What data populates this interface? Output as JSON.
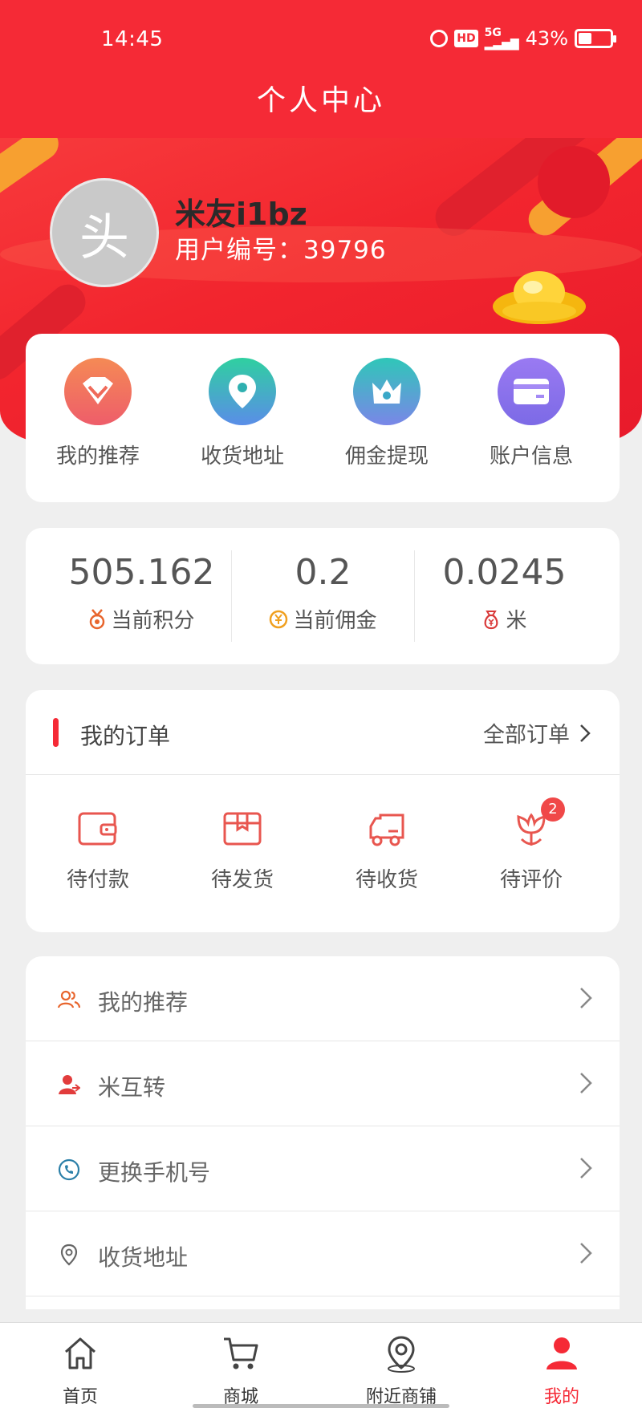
{
  "status_bar": {
    "time": "14:45",
    "network": "5G",
    "battery_text": "43%",
    "battery_level": 0.43,
    "hd_label": "HD"
  },
  "header": {
    "title": "个人中心"
  },
  "profile": {
    "avatar_text": "头",
    "name": "米友i1bz",
    "user_id_label": "用户编号：39796"
  },
  "quick_actions": [
    {
      "label": "我的推荐",
      "icon": "diamond-icon",
      "color": "#f0744c"
    },
    {
      "label": "收货地址",
      "icon": "location-pin-icon",
      "color": "#2ec7a2"
    },
    {
      "label": "佣金提现",
      "icon": "crown-icon",
      "color": "#36b7c7"
    },
    {
      "label": "账户信息",
      "icon": "card-icon",
      "color": "#8a6ff0"
    }
  ],
  "stats": [
    {
      "value": "505.162",
      "label": "当前积分",
      "icon": "medal-icon",
      "color": "#e8652d"
    },
    {
      "value": "0.2",
      "label": "当前佣金",
      "icon": "yen-coin-icon",
      "color": "#f0a020"
    },
    {
      "value": "0.0245",
      "label": "米",
      "icon": "money-bag-icon",
      "color": "#d93a3a"
    }
  ],
  "orders": {
    "title": "我的订单",
    "view_all": "全部订单",
    "items": [
      {
        "label": "待付款",
        "icon": "wallet-icon",
        "badge": null
      },
      {
        "label": "待发货",
        "icon": "package-icon",
        "badge": null
      },
      {
        "label": "待收货",
        "icon": "truck-icon",
        "badge": null
      },
      {
        "label": "待评价",
        "icon": "flower-icon",
        "badge": "2"
      }
    ]
  },
  "menu": [
    {
      "label": "我的推荐",
      "icon": "users-icon",
      "color": "#e8652d"
    },
    {
      "label": "米互转",
      "icon": "user-transfer-icon",
      "color": "#e23c3c"
    },
    {
      "label": "更换手机号",
      "icon": "phone-icon",
      "color": "#2b7fa8"
    },
    {
      "label": "收货地址",
      "icon": "map-pin-icon",
      "color": "#666666"
    }
  ],
  "tabbar": {
    "items": [
      {
        "label": "首页",
        "icon": "home-icon",
        "active": false
      },
      {
        "label": "商城",
        "icon": "cart-icon",
        "active": false
      },
      {
        "label": "附近商铺",
        "icon": "nearby-pin-icon",
        "active": false
      },
      {
        "label": "我的",
        "icon": "profile-icon",
        "active": true
      }
    ]
  },
  "colors": {
    "brand_red": "#f52a36",
    "text_gray": "#555555",
    "background": "#efefef"
  }
}
